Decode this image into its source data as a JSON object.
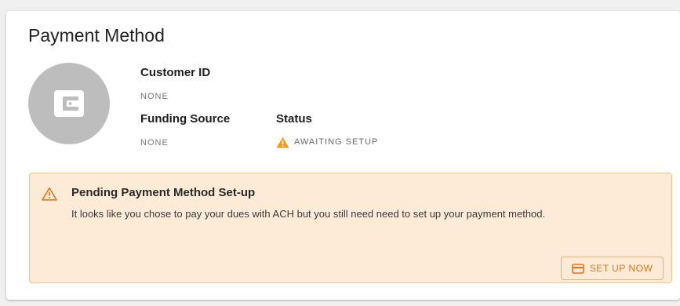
{
  "card": {
    "title": "Payment Method"
  },
  "avatar": {
    "icon": "wallet-icon",
    "bg_color": "#bdbdbd"
  },
  "fields": {
    "customer_id": {
      "label": "Customer ID",
      "value": "NONE"
    },
    "funding_source": {
      "label": "Funding Source",
      "value": "NONE"
    },
    "status": {
      "label": "Status",
      "value": "AWAITING SETUP",
      "icon": "warning-icon",
      "icon_color": "#f39c12"
    }
  },
  "alert": {
    "icon": "warning-outline-icon",
    "title": "Pending Payment Method Set-up",
    "body": "It looks like you chose to pay your dues with ACH but you still need need to set up your payment method.",
    "bg_color": "#fdebd8",
    "border_color": "#f0c88e",
    "button": {
      "label": "SET UP NOW",
      "icon": "credit-card-icon",
      "color": "#e0761f"
    }
  }
}
